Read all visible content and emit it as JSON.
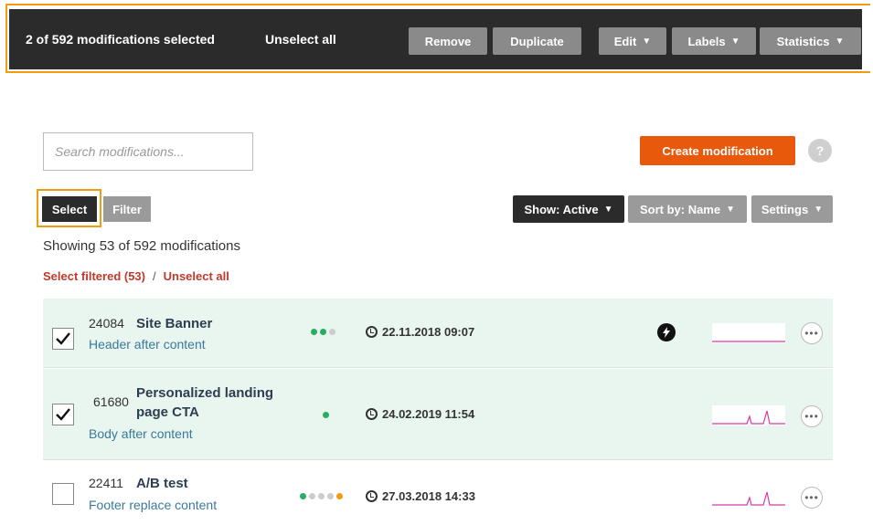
{
  "topbar": {
    "selected_count": "2 of 592 modifications selected",
    "unselect_all": "Unselect all",
    "buttons": {
      "remove": "Remove",
      "duplicate": "Duplicate",
      "edit": "Edit",
      "labels": "Labels",
      "statistics": "Statistics"
    }
  },
  "search": {
    "placeholder": "Search modifications..."
  },
  "create_button": "Create modification",
  "help_button": "?",
  "toolbar": {
    "select": "Select",
    "filter": "Filter",
    "show": "Show: Active",
    "sort": "Sort by: Name",
    "settings": "Settings"
  },
  "showing_text": "Showing 53 of 592 modifications",
  "selection_links": {
    "select_filtered": "Select filtered (53)",
    "separator": "/",
    "unselect_all": "Unselect all"
  },
  "colors": {
    "accent": "#e8590c",
    "highlight_outline": "#f39c12",
    "dot_green": "#27ae60",
    "dot_gray": "#cccccc",
    "dot_orange": "#f39c12",
    "spark": "#d63aa8"
  },
  "rows": [
    {
      "id": "24084",
      "name": "Site Banner",
      "name_line2": "",
      "subtitle": "Header after content",
      "checked": true,
      "dots": [
        "green",
        "green",
        "gray"
      ],
      "date": "22.11.2018 09:07",
      "has_bolt": true
    },
    {
      "id": "61680",
      "name": "Personalized landing",
      "name_line2": "page CTA",
      "subtitle": "Body after content",
      "checked": true,
      "dots": [
        "green"
      ],
      "date": "24.02.2019 11:54",
      "has_bolt": false
    },
    {
      "id": "22411",
      "name": "A/B test",
      "name_line2": "",
      "subtitle": "Footer replace content",
      "checked": false,
      "dots": [
        "green",
        "gray",
        "gray",
        "gray",
        "orange"
      ],
      "date": "27.03.2018 14:33",
      "has_bolt": false
    }
  ]
}
